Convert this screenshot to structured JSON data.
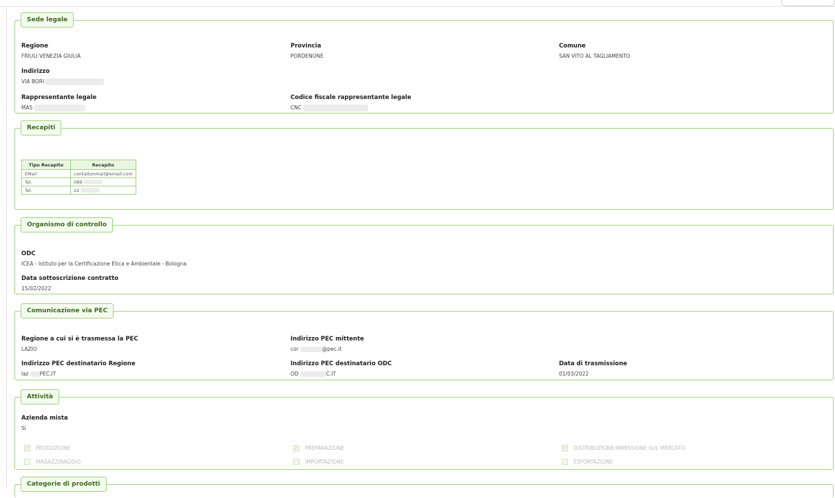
{
  "sede": {
    "legend": "Sede legale",
    "regione_label": "Regione",
    "regione_value": "FRIULI VENEZIA GIULIA",
    "provincia_label": "Provincia",
    "provincia_value": "PORDENONE",
    "comune_label": "Comune",
    "comune_value": "SAN VITO AL TAGLIAMENTO",
    "indirizzo_label": "Indirizzo",
    "indirizzo_value": "VIA BORI",
    "rapp_label": "Rappresentante legale",
    "rapp_value": "MAS",
    "cf_label": "Codice fiscale rappresentante legale",
    "cf_value": "CNC"
  },
  "recapiti": {
    "legend": "Recapiti",
    "headers": [
      "Tipo Recapito",
      "Recapito"
    ],
    "rows": [
      {
        "tipo": "EMail",
        "valore": "contattonmail@email.com"
      },
      {
        "tipo": "Tel.",
        "valore": "089"
      },
      {
        "tipo": "Tel.",
        "valore": "22"
      }
    ]
  },
  "organismo": {
    "legend": "Organismo di controllo",
    "odc_label": "ODC",
    "odc_value": "ICEA - Istituto per la Certificazione Etica e Ambientale - Bologna",
    "data_label": "Data sottoscrizione contratto",
    "data_value": "15/02/2022"
  },
  "pec": {
    "legend": "Comunicazione via PEC",
    "regione_label": "Regione a cui si è trasmessa la PEC",
    "regione_value": "LAZIO",
    "mittente_label": "Indirizzo PEC mittente",
    "mittente_pre": "cor",
    "mittente_post": "@pec.it",
    "dest_reg_label": "Indirizzo PEC destinatario Regione",
    "dest_reg_pre": "laz",
    "dest_reg_post": "PEC.IT",
    "dest_odc_label": "Indirizzo PEC destinatario ODC",
    "dest_odc_pre": "OD",
    "dest_odc_post": "C.IT",
    "data_label": "Data di trasmissione",
    "data_value": "01/03/2022"
  },
  "attivita": {
    "legend": "Attività",
    "mista_label": "Azienda mista",
    "mista_value": "Si",
    "checks": [
      {
        "label": "PRODUZIONE",
        "checked": true
      },
      {
        "label": "PREPARAZIONE",
        "checked": true
      },
      {
        "label": "DISTRIBUZIONE/IMMISSIONE SUL MERCATO",
        "checked": true
      },
      {
        "label": "MAGAZZINAGGIO",
        "checked": false
      },
      {
        "label": "IMPORTAZIONE",
        "checked": false
      },
      {
        "label": "ESPORTAZIONE",
        "checked": false
      }
    ]
  },
  "categorie": {
    "legend": "Categorie di prodotti"
  }
}
